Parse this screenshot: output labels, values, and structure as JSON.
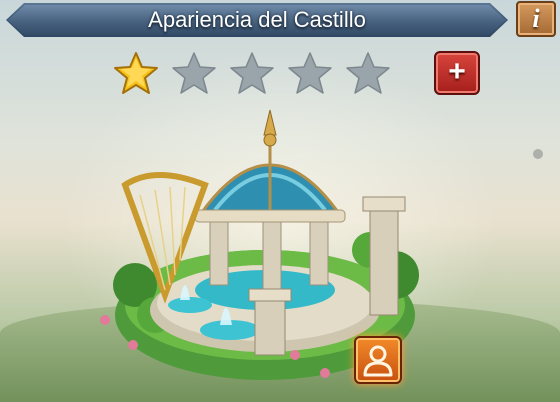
{
  "header": {
    "title": "Apariencia del Castillo",
    "info_label": "i"
  },
  "stars": {
    "filled": 1,
    "total": 5,
    "filled_color": "#f5c21c",
    "empty_color": "#9aa4ab"
  },
  "add_button": {
    "label": "+"
  },
  "castle": {
    "icon": "castle-skin-harp-fountain"
  },
  "preview_button": {
    "icon": "person-icon"
  }
}
